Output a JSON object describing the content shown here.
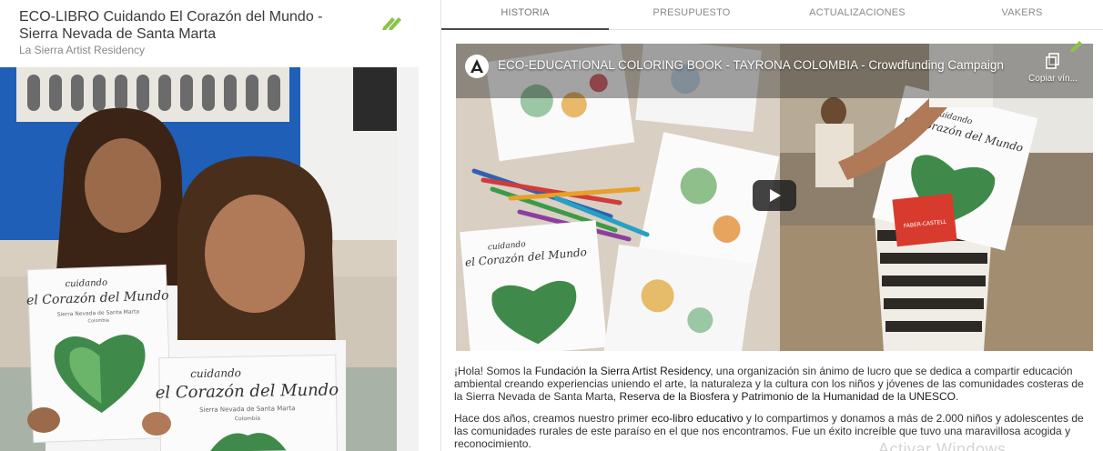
{
  "project": {
    "title": "ECO-LIBRO Cuidando El Corazón del Mundo - Sierra Nevada de Santa Marta",
    "subtitle": "La Sierra Artist Residency"
  },
  "book_cover": {
    "line1": "cuidando",
    "line2": "el Corazón del Mundo",
    "line3": "Sierra Nevada de Santa Marta",
    "line4": "Colombia"
  },
  "tabs": [
    {
      "label": "HISTORIA",
      "active": true
    },
    {
      "label": "PRESUPUESTO",
      "active": false
    },
    {
      "label": "ACTUALIZACIONES",
      "active": false
    },
    {
      "label": "VAKERS",
      "active": false
    }
  ],
  "video": {
    "title": "ECO-EDUCATIONAL COLORING BOOK - TAYRONA COLOMBIA - Crowdfunding Campaign",
    "copy_link_label": "Copiar vín...",
    "crayon_box": "FABER-CASTELL"
  },
  "story": {
    "p1_a": "¡Hola! Somos la ",
    "p1_b": "Fundación la Sierra Artist Residency",
    "p1_c": ", una organización sin ánimo de lucro que se dedica a compartir educación ambiental creando experiencias uniendo el arte, la naturaleza y la cultura con los niños y jóvenes de las comunidades costeras de la Sierra Nevada de Santa Marta, ",
    "p1_d": "Reserva de la Biosfera y Patrimonio de la Humanidad de la UNESCO",
    "p1_e": ".",
    "p2_a": "Hace dos años, creamos nuestro primer ",
    "p2_b": "eco-libro educativo",
    "p2_c": " y lo compartimos y donamos a más de 2.000 niños y adolescentes de las comunidades rurales de este paraíso en el que nos encontramos. Fue un éxito increíble que tuvo una maravillosa acogida y reconocimiento."
  },
  "watermark": "Activar Windows",
  "colors": {
    "edit_icon": "#8bc34a",
    "active_tab_underline": "#4a4a4a",
    "wall_blue": "#1f5fb8"
  },
  "icons": [
    "edit-pencil-icon",
    "copy-icon",
    "play-icon",
    "channel-logo-icon"
  ]
}
